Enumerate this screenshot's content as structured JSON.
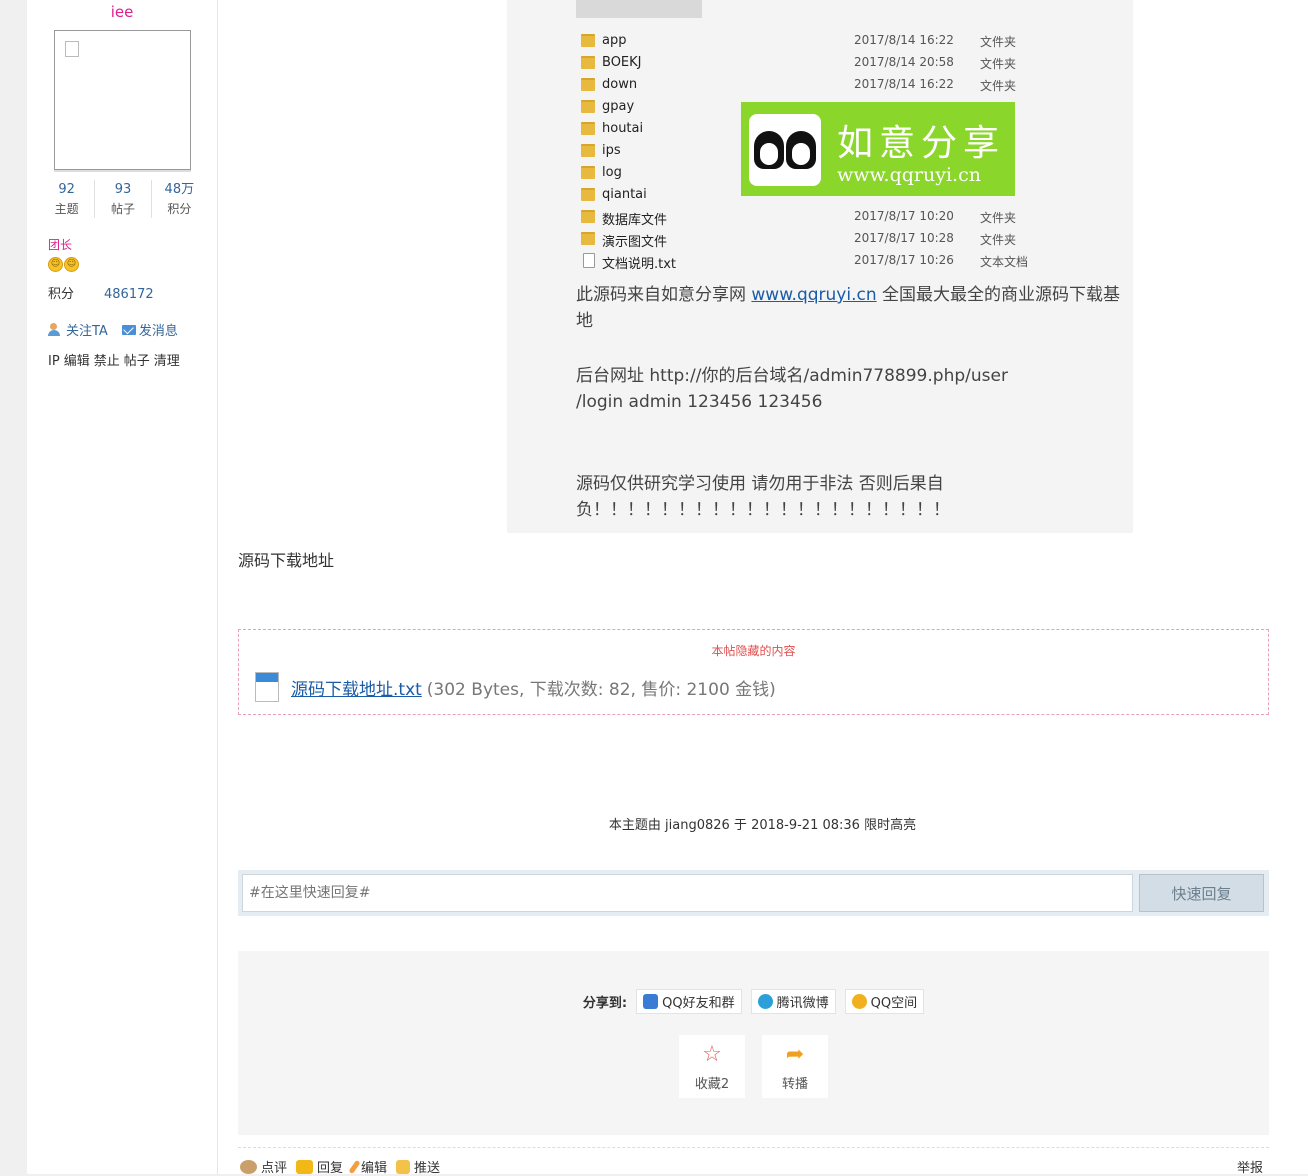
{
  "user": {
    "name": "iee",
    "stats": [
      {
        "num": "92",
        "label": "主题"
      },
      {
        "num": "93",
        "label": "帖子"
      },
      {
        "num": "48万",
        "label": "积分"
      }
    ],
    "rank": "团长",
    "score_label": "积分",
    "score_value": "486172",
    "follow": "关注TA",
    "message": "发消息",
    "admin": [
      "IP",
      "编辑",
      "禁止",
      "帖子",
      "清理"
    ]
  },
  "screenshot": {
    "files": [
      {
        "name": "app",
        "date": "2017/8/14 16:22",
        "type": "文件夹"
      },
      {
        "name": "BOEKJ",
        "date": "2017/8/14 20:58",
        "type": "文件夹"
      },
      {
        "name": "down",
        "date": "2017/8/14 16:22",
        "type": "文件夹"
      },
      {
        "name": "gpay",
        "date": "",
        "type": ""
      },
      {
        "name": "houtai",
        "date": "",
        "type": ""
      },
      {
        "name": "ips",
        "date": "",
        "type": ""
      },
      {
        "name": "log",
        "date": "",
        "type": ""
      },
      {
        "name": "qiantai",
        "date": "",
        "type": ""
      },
      {
        "name": "数据库文件",
        "date": "2017/8/17 10:20",
        "type": "文件夹"
      },
      {
        "name": "演示图文件",
        "date": "2017/8/17 10:28",
        "type": "文件夹"
      },
      {
        "name": "文档说明.txt",
        "date": "2017/8/17 10:26",
        "type": "文本文档"
      }
    ],
    "watermark_title": "如意分享",
    "watermark_url": "www.qqruyi.cn",
    "line1_prefix": "此源码来自如意分享网 ",
    "line1_link": "www.qqruyi.cn",
    "line1_suffix": "  全国最大最全的商业源码下载基地",
    "line2a": "后台网址  http://你的后台域名/admin778899.php/user",
    "line2b": "/login  admin  123456  123456",
    "line3a": "源码仅供研究学习使用 请勿用于非法 否则后果自",
    "line3b": "负！！！！！！！！！！！！！！！！！！！！！"
  },
  "download_title": "源码下载地址",
  "hidden": {
    "notice": "本帖隐藏的内容",
    "file_name": "源码下载地址.txt",
    "file_meta": "(302 Bytes, 下载次数: 82, 售价: 2100 金钱)"
  },
  "highlight_note": "本主题由 jiang0826 于 2018-9-21 08:36 限时高亮",
  "quick_reply": {
    "placeholder": "#在这里快速回复#",
    "button": "快速回复"
  },
  "share": {
    "label": "分享到:",
    "targets": [
      "QQ好友和群",
      "腾讯微博",
      "QQ空间"
    ],
    "favorite": "收藏",
    "favorite_count": "2",
    "forward": "转播"
  },
  "bottom": {
    "comment": "点评",
    "reply": "回复",
    "edit": "编辑",
    "push": "推送",
    "report": "举报"
  },
  "colors": {
    "accent_pink": "#e0208c",
    "link_blue": "#336699",
    "watermark_green": "#8bd62a",
    "hidden_red": "#e05050"
  }
}
